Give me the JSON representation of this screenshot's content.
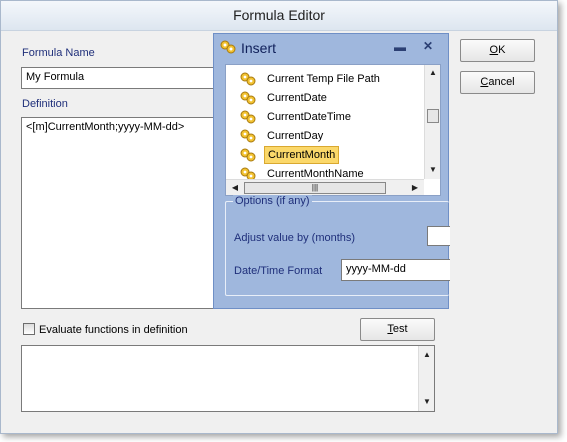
{
  "dialog": {
    "title": "Formula Editor",
    "formula_name_label": "Formula Name",
    "formula_name_value": "My Formula",
    "definition_label": "Definition",
    "definition_value": "<[m]CurrentMonth;yyyy-MM-dd>",
    "ok_button": "OK",
    "cancel_button": "Cancel",
    "test_button": "Test",
    "evaluate_checkbox_label": "Evaluate functions in definition",
    "evaluate_checked": false,
    "output_value": ""
  },
  "insert_panel": {
    "title": "Insert",
    "items": [
      {
        "label": "Current Temp File Path",
        "selected": false
      },
      {
        "label": "CurrentDate",
        "selected": false
      },
      {
        "label": "CurrentDateTime",
        "selected": false
      },
      {
        "label": "CurrentDay",
        "selected": false
      },
      {
        "label": "CurrentMonth",
        "selected": true
      },
      {
        "label": "CurrentMonthName",
        "selected": false
      }
    ],
    "options_label": "Options (if any)",
    "adjust_label": "Adjust value by (months)",
    "adjust_value": "",
    "datetime_format_label": "Date/Time Format",
    "datetime_format_value": "yyyy-MM-dd"
  },
  "colors": {
    "label_blue": "#1f2f7a",
    "panel_blue": "#9fb7dd",
    "selection_yellow": "#fbd86a"
  },
  "icons": [
    "function-icon",
    "minimize-icon",
    "close-icon",
    "scroll-up-icon",
    "scroll-down-icon",
    "scroll-left-icon",
    "scroll-right-icon"
  ]
}
